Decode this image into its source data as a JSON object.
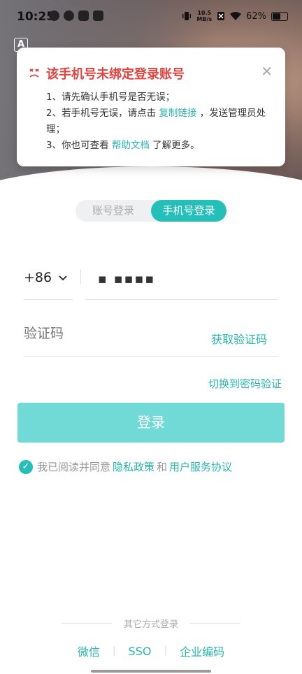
{
  "status_bar": {
    "time": "10:25",
    "speed_value": "10.5",
    "speed_unit": "MB/s",
    "battery": "62%"
  },
  "alert": {
    "title": "该手机号未绑定登录账号",
    "line1": "1、请先确认手机号是否无误；",
    "line2_prefix": "2、若手机号无误，请点击 ",
    "line2_link": "复制链接",
    "line2_suffix": " ，发送管理员处理；",
    "line3_prefix": "3、你也可查看 ",
    "line3_link": "帮助文档",
    "line3_suffix": " 了解更多。"
  },
  "tabs": {
    "account": "账号登录",
    "phone": "手机号登录"
  },
  "form": {
    "country_code": "+86",
    "phone_value": "▪ ▪▪▪▪",
    "code_placeholder": "验证码",
    "get_code": "获取验证码",
    "switch_password": "切换到密码验证",
    "login_button": "登录"
  },
  "agreement": {
    "prefix": "我已阅读并同意",
    "privacy": "隐私政策",
    "and": "和",
    "terms": "用户服务协议"
  },
  "other_methods": {
    "title": "其它方式登录",
    "wechat": "微信",
    "sso": "SSO",
    "enterprise": "企业编码"
  },
  "colors": {
    "accent": "#24bfb8",
    "error": "#e0443e",
    "button_disabled": "#71dad6"
  }
}
